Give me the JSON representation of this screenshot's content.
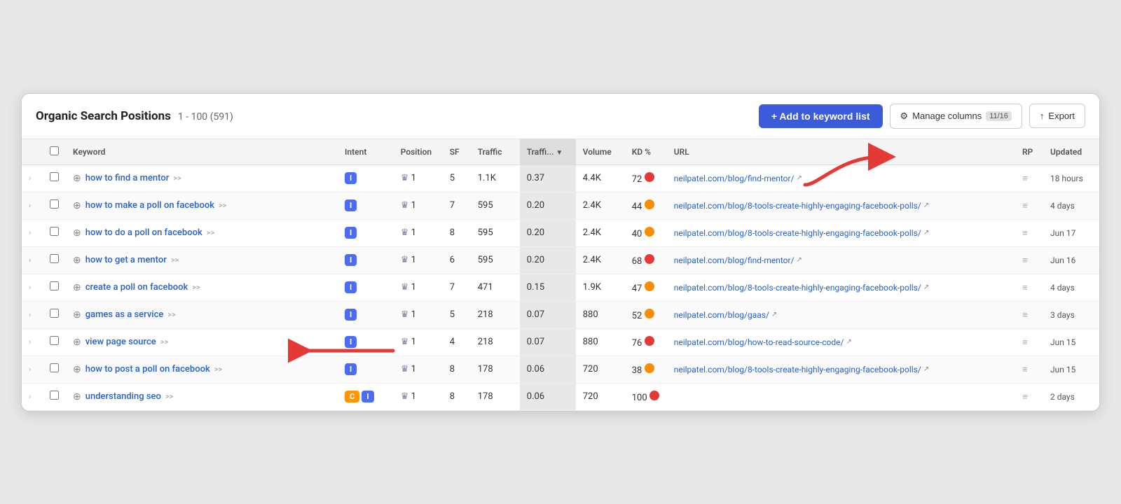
{
  "header": {
    "title": "Organic Search Positions",
    "range": "1 - 100 (591)",
    "add_btn": "+ Add to keyword list",
    "manage_btn": "Manage columns",
    "manage_badge": "11/16",
    "export_btn": "Export"
  },
  "columns": [
    "",
    "",
    "Keyword",
    "Intent",
    "Position",
    "SF",
    "Traffic",
    "Traffi...",
    "Volume",
    "KD %",
    "URL",
    "RP",
    "Updated"
  ],
  "rows": [
    {
      "keyword": "how to find a mentor",
      "intent": [
        "I"
      ],
      "position": "1",
      "sf": "5",
      "traffic": "1.1K",
      "traffic_pct": "0.37",
      "volume": "4.4K",
      "kd": "72",
      "kd_color": "red",
      "url": "neilpatel.com/blog/find-mentor/",
      "rp": "",
      "updated": "18 hours"
    },
    {
      "keyword": "how to make a poll on facebook",
      "intent": [
        "I"
      ],
      "position": "1",
      "sf": "7",
      "traffic": "595",
      "traffic_pct": "0.20",
      "volume": "2.4K",
      "kd": "44",
      "kd_color": "orange",
      "url": "neilpatel.com/blog/8-tools-create-highly-engaging-facebook-polls/",
      "rp": "",
      "updated": "4 days"
    },
    {
      "keyword": "how to do a poll on facebook",
      "intent": [
        "I"
      ],
      "position": "1",
      "sf": "8",
      "traffic": "595",
      "traffic_pct": "0.20",
      "volume": "2.4K",
      "kd": "40",
      "kd_color": "orange",
      "url": "neilpatel.com/blog/8-tools-create-highly-engaging-facebook-polls/",
      "rp": "",
      "updated": "Jun 17"
    },
    {
      "keyword": "how to get a mentor",
      "intent": [
        "I"
      ],
      "position": "1",
      "sf": "6",
      "traffic": "595",
      "traffic_pct": "0.20",
      "volume": "2.4K",
      "kd": "68",
      "kd_color": "red",
      "url": "neilpatel.com/blog/find-mentor/",
      "rp": "",
      "updated": "Jun 16"
    },
    {
      "keyword": "create a poll on facebook",
      "intent": [
        "I"
      ],
      "position": "1",
      "sf": "7",
      "traffic": "471",
      "traffic_pct": "0.15",
      "volume": "1.9K",
      "kd": "47",
      "kd_color": "orange",
      "url": "neilpatel.com/blog/8-tools-create-highly-engaging-facebook-polls/",
      "rp": "",
      "updated": "4 days"
    },
    {
      "keyword": "games as a service",
      "intent": [
        "I"
      ],
      "position": "1",
      "sf": "5",
      "traffic": "218",
      "traffic_pct": "0.07",
      "volume": "880",
      "kd": "52",
      "kd_color": "orange",
      "url": "neilpatel.com/blog/gaas/",
      "rp": "",
      "updated": "3 days"
    },
    {
      "keyword": "view page source",
      "intent": [
        "I"
      ],
      "position": "1",
      "sf": "4",
      "traffic": "218",
      "traffic_pct": "0.07",
      "volume": "880",
      "kd": "76",
      "kd_color": "red",
      "url": "neilpatel.com/blog/how-to-read-source-code/",
      "rp": "",
      "updated": "Jun 15"
    },
    {
      "keyword": "how to post a poll on facebook",
      "intent": [
        "I"
      ],
      "position": "1",
      "sf": "8",
      "traffic": "178",
      "traffic_pct": "0.06",
      "volume": "720",
      "kd": "38",
      "kd_color": "orange",
      "url": "neilpatel.com/blog/8-tools-create-highly-engaging-facebook-polls/",
      "rp": "",
      "updated": "Jun 15"
    },
    {
      "keyword": "understanding seo",
      "intent": [
        "C",
        "I"
      ],
      "position": "1",
      "sf": "8",
      "traffic": "178",
      "traffic_pct": "0.06",
      "volume": "720",
      "kd": "100",
      "kd_color": "red",
      "url": "",
      "rp": "",
      "updated": "2 days"
    }
  ]
}
